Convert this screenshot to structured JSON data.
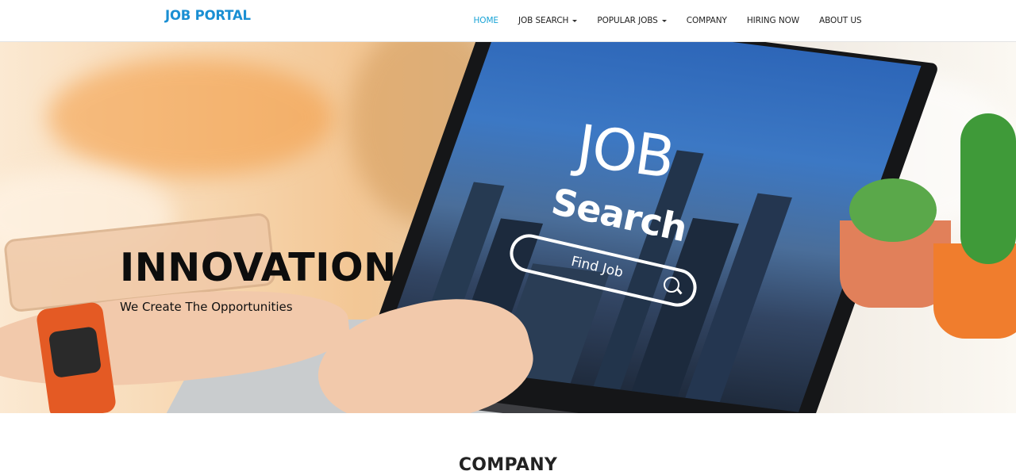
{
  "brand": {
    "name": "JOB PORTAL"
  },
  "nav": {
    "items": [
      {
        "label": "HOME",
        "active": true,
        "dropdown": false
      },
      {
        "label": "JOB SEARCH",
        "active": false,
        "dropdown": true
      },
      {
        "label": "POPULAR JOBS",
        "active": false,
        "dropdown": true
      },
      {
        "label": "COMPANY",
        "active": false,
        "dropdown": false
      },
      {
        "label": "HIRING NOW",
        "active": false,
        "dropdown": false
      },
      {
        "label": "ABOUT US",
        "active": false,
        "dropdown": false
      }
    ]
  },
  "hero": {
    "title": "INNOVATION",
    "subtitle": "We Create The Opportunities",
    "image": {
      "screen_title": "JOB",
      "screen_subtitle": "Search",
      "screen_placeholder": "Find Job"
    }
  },
  "section": {
    "title": "COMPANY"
  },
  "colors": {
    "brand": "#1a8fd3",
    "nav_active": "#18a3d6",
    "text": "#222222"
  }
}
